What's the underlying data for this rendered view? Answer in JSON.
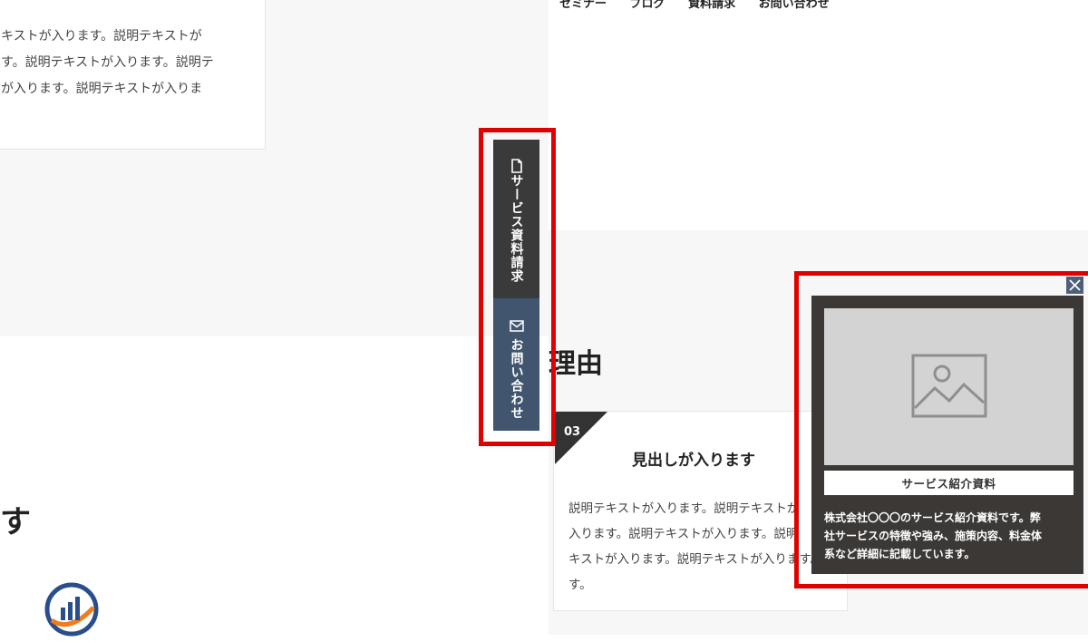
{
  "nav": {
    "items": [
      "セミナー",
      "ブログ",
      "資料請求",
      "お問い合わせ"
    ]
  },
  "left_card": {
    "lines": [
      "キストが入ります。説明テキストが",
      "す。説明テキストが入ります。説明テ",
      "が入ります。説明テキストが入りま"
    ]
  },
  "left_heading_fragment": "す",
  "right_heading_fragment": "理由",
  "card3": {
    "number": "03",
    "heading": "見出しが入ります",
    "lines": [
      "説明テキストが入ります。説明テキストが",
      "入ります。説明テキストが入ります。説明",
      "キストが入ります。説明テキストが入ります。",
      "す。"
    ]
  },
  "side_buttons": {
    "document": {
      "label": "サービス資料請求",
      "icon": "document-icon"
    },
    "contact": {
      "label": "お問い合わせ",
      "icon": "mail-icon"
    }
  },
  "popup": {
    "label": "サービス紹介資料",
    "description_lines": [
      "株式会社〇〇〇のサービス紹介資料です。弊",
      "社サービスの特徴や強み、施策内容、料金体",
      "系など詳細に記載しています。"
    ],
    "image_icon": "image-placeholder-icon",
    "close_icon": "close-icon"
  },
  "colors": {
    "highlight": "#e00000",
    "dark_button": "#3a3a3a",
    "contact_button": "#41566e",
    "popup_bg": "#3b3836",
    "logo_orange": "#f07c1e",
    "logo_navy": "#2a4d8c"
  }
}
